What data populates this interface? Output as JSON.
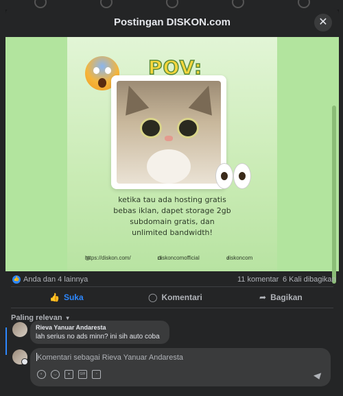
{
  "modal": {
    "title": "Postingan DISKON.com",
    "close_label": "✕"
  },
  "post_image": {
    "heading": "POV:",
    "caption_lines": [
      "ketika tau ada hosting gratis",
      "bebas iklan, dapet storage 2gb",
      "subdomain gratis, dan",
      "unlimited bandwidth!"
    ],
    "website": "https://diskon.com/",
    "instagram": "diskoncomofficial",
    "tiktok": "diskoncom"
  },
  "stats": {
    "reactions": "Anda dan 4 lainnya",
    "comments": "11 komentar",
    "shares": "6 Kali dibagikan"
  },
  "actions": {
    "like": "Suka",
    "comment": "Komentari",
    "share": "Bagikan"
  },
  "sort": {
    "label": "Paling relevan"
  },
  "comments": [
    {
      "author": "Rieva Yanuar Andaresta",
      "text": "lah serius no ads minn? ini sih auto coba"
    }
  ],
  "composer": {
    "placeholder": "Komentari sebagai Rieva Yanuar Andaresta",
    "value": ""
  },
  "colors": {
    "accent": "#2d88ff",
    "image_bg": "#b2e49e"
  }
}
